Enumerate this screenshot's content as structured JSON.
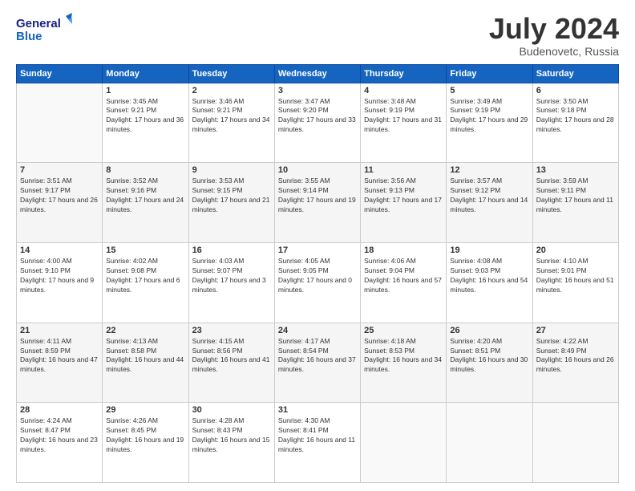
{
  "header": {
    "logo_line1": "General",
    "logo_line2": "Blue",
    "month_title": "July 2024",
    "location": "Budenovetc, Russia"
  },
  "weekdays": [
    "Sunday",
    "Monday",
    "Tuesday",
    "Wednesday",
    "Thursday",
    "Friday",
    "Saturday"
  ],
  "weeks": [
    [
      {
        "day": "",
        "sunrise": "",
        "sunset": "",
        "daylight": ""
      },
      {
        "day": "1",
        "sunrise": "Sunrise: 3:45 AM",
        "sunset": "Sunset: 9:21 PM",
        "daylight": "Daylight: 17 hours and 36 minutes."
      },
      {
        "day": "2",
        "sunrise": "Sunrise: 3:46 AM",
        "sunset": "Sunset: 9:21 PM",
        "daylight": "Daylight: 17 hours and 34 minutes."
      },
      {
        "day": "3",
        "sunrise": "Sunrise: 3:47 AM",
        "sunset": "Sunset: 9:20 PM",
        "daylight": "Daylight: 17 hours and 33 minutes."
      },
      {
        "day": "4",
        "sunrise": "Sunrise: 3:48 AM",
        "sunset": "Sunset: 9:19 PM",
        "daylight": "Daylight: 17 hours and 31 minutes."
      },
      {
        "day": "5",
        "sunrise": "Sunrise: 3:49 AM",
        "sunset": "Sunset: 9:19 PM",
        "daylight": "Daylight: 17 hours and 29 minutes."
      },
      {
        "day": "6",
        "sunrise": "Sunrise: 3:50 AM",
        "sunset": "Sunset: 9:18 PM",
        "daylight": "Daylight: 17 hours and 28 minutes."
      }
    ],
    [
      {
        "day": "7",
        "sunrise": "Sunrise: 3:51 AM",
        "sunset": "Sunset: 9:17 PM",
        "daylight": "Daylight: 17 hours and 26 minutes."
      },
      {
        "day": "8",
        "sunrise": "Sunrise: 3:52 AM",
        "sunset": "Sunset: 9:16 PM",
        "daylight": "Daylight: 17 hours and 24 minutes."
      },
      {
        "day": "9",
        "sunrise": "Sunrise: 3:53 AM",
        "sunset": "Sunset: 9:15 PM",
        "daylight": "Daylight: 17 hours and 21 minutes."
      },
      {
        "day": "10",
        "sunrise": "Sunrise: 3:55 AM",
        "sunset": "Sunset: 9:14 PM",
        "daylight": "Daylight: 17 hours and 19 minutes."
      },
      {
        "day": "11",
        "sunrise": "Sunrise: 3:56 AM",
        "sunset": "Sunset: 9:13 PM",
        "daylight": "Daylight: 17 hours and 17 minutes."
      },
      {
        "day": "12",
        "sunrise": "Sunrise: 3:57 AM",
        "sunset": "Sunset: 9:12 PM",
        "daylight": "Daylight: 17 hours and 14 minutes."
      },
      {
        "day": "13",
        "sunrise": "Sunrise: 3:59 AM",
        "sunset": "Sunset: 9:11 PM",
        "daylight": "Daylight: 17 hours and 11 minutes."
      }
    ],
    [
      {
        "day": "14",
        "sunrise": "Sunrise: 4:00 AM",
        "sunset": "Sunset: 9:10 PM",
        "daylight": "Daylight: 17 hours and 9 minutes."
      },
      {
        "day": "15",
        "sunrise": "Sunrise: 4:02 AM",
        "sunset": "Sunset: 9:08 PM",
        "daylight": "Daylight: 17 hours and 6 minutes."
      },
      {
        "day": "16",
        "sunrise": "Sunrise: 4:03 AM",
        "sunset": "Sunset: 9:07 PM",
        "daylight": "Daylight: 17 hours and 3 minutes."
      },
      {
        "day": "17",
        "sunrise": "Sunrise: 4:05 AM",
        "sunset": "Sunset: 9:05 PM",
        "daylight": "Daylight: 17 hours and 0 minutes."
      },
      {
        "day": "18",
        "sunrise": "Sunrise: 4:06 AM",
        "sunset": "Sunset: 9:04 PM",
        "daylight": "Daylight: 16 hours and 57 minutes."
      },
      {
        "day": "19",
        "sunrise": "Sunrise: 4:08 AM",
        "sunset": "Sunset: 9:03 PM",
        "daylight": "Daylight: 16 hours and 54 minutes."
      },
      {
        "day": "20",
        "sunrise": "Sunrise: 4:10 AM",
        "sunset": "Sunset: 9:01 PM",
        "daylight": "Daylight: 16 hours and 51 minutes."
      }
    ],
    [
      {
        "day": "21",
        "sunrise": "Sunrise: 4:11 AM",
        "sunset": "Sunset: 8:59 PM",
        "daylight": "Daylight: 16 hours and 47 minutes."
      },
      {
        "day": "22",
        "sunrise": "Sunrise: 4:13 AM",
        "sunset": "Sunset: 8:58 PM",
        "daylight": "Daylight: 16 hours and 44 minutes."
      },
      {
        "day": "23",
        "sunrise": "Sunrise: 4:15 AM",
        "sunset": "Sunset: 8:56 PM",
        "daylight": "Daylight: 16 hours and 41 minutes."
      },
      {
        "day": "24",
        "sunrise": "Sunrise: 4:17 AM",
        "sunset": "Sunset: 8:54 PM",
        "daylight": "Daylight: 16 hours and 37 minutes."
      },
      {
        "day": "25",
        "sunrise": "Sunrise: 4:18 AM",
        "sunset": "Sunset: 8:53 PM",
        "daylight": "Daylight: 16 hours and 34 minutes."
      },
      {
        "day": "26",
        "sunrise": "Sunrise: 4:20 AM",
        "sunset": "Sunset: 8:51 PM",
        "daylight": "Daylight: 16 hours and 30 minutes."
      },
      {
        "day": "27",
        "sunrise": "Sunrise: 4:22 AM",
        "sunset": "Sunset: 8:49 PM",
        "daylight": "Daylight: 16 hours and 26 minutes."
      }
    ],
    [
      {
        "day": "28",
        "sunrise": "Sunrise: 4:24 AM",
        "sunset": "Sunset: 8:47 PM",
        "daylight": "Daylight: 16 hours and 23 minutes."
      },
      {
        "day": "29",
        "sunrise": "Sunrise: 4:26 AM",
        "sunset": "Sunset: 8:45 PM",
        "daylight": "Daylight: 16 hours and 19 minutes."
      },
      {
        "day": "30",
        "sunrise": "Sunrise: 4:28 AM",
        "sunset": "Sunset: 8:43 PM",
        "daylight": "Daylight: 16 hours and 15 minutes."
      },
      {
        "day": "31",
        "sunrise": "Sunrise: 4:30 AM",
        "sunset": "Sunset: 8:41 PM",
        "daylight": "Daylight: 16 hours and 11 minutes."
      },
      {
        "day": "",
        "sunrise": "",
        "sunset": "",
        "daylight": ""
      },
      {
        "day": "",
        "sunrise": "",
        "sunset": "",
        "daylight": ""
      },
      {
        "day": "",
        "sunrise": "",
        "sunset": "",
        "daylight": ""
      }
    ]
  ]
}
